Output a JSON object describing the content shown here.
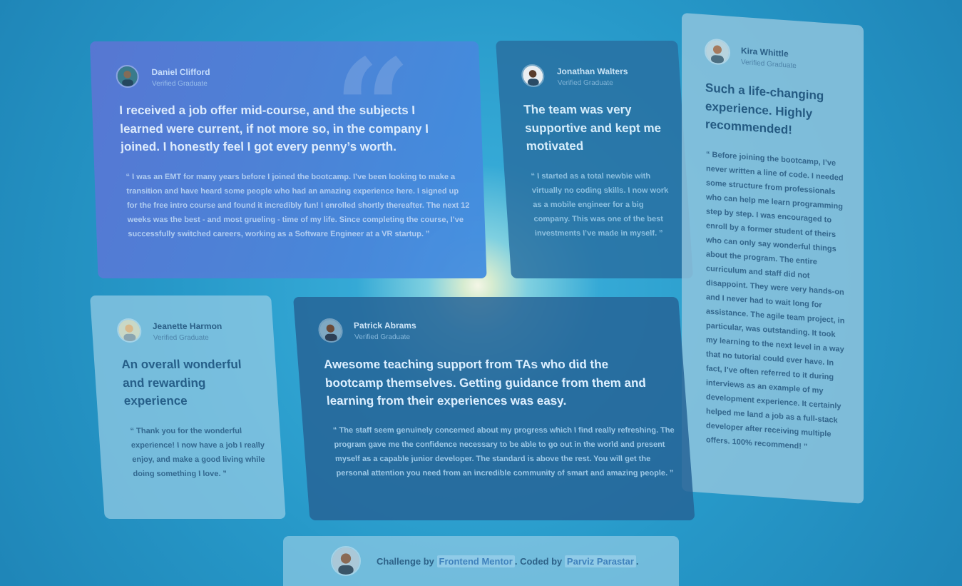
{
  "testimonials": [
    {
      "name": "Daniel Clifford",
      "role": "Verified Graduate",
      "headline": "I received a job offer mid-course, and the subjects I learned were current, if not more so, in the company I joined. I honestly feel I got every penny’s worth.",
      "quote": "“ I was an EMT for many years before I joined the bootcamp. I’ve been looking to make a transition and have heard some people who had an amazing experience here. I signed up for the free intro course and found it incredibly fun! I enrolled shortly thereafter. The next 12 weeks was the best - and most grueling - time of my life. Since completing the course, I’ve successfully switched careers, working as a Software Engineer at a VR startup. ”"
    },
    {
      "name": "Jonathan Walters",
      "role": "Verified Graduate",
      "headline": "The team was very supportive and kept me motivated",
      "quote": "“ I started as a total newbie with virtually no coding skills. I now work as a mobile engineer for a big company. This was one of the best investments I’ve made in myself. ”"
    },
    {
      "name": "Kira Whittle",
      "role": "Verified Graduate",
      "headline": "Such a life-changing experience. Highly recommended!",
      "quote": "“ Before joining the bootcamp, I’ve never written a line of code. I needed some structure from professionals who can help me learn programming step by step. I was encouraged to enroll by a former student of theirs who can only say wonderful things about the program. The entire curriculum and staff did not disappoint. They were very hands-on and I never had to wait long for assistance. The agile team project, in particular, was outstanding. It took my learning to the next level in a way that no tutorial could ever have. In fact, I’ve often referred to it during interviews as an example of my development experience. It certainly helped me land a job as a full-stack developer after receiving multiple offers. 100% recommend! ”"
    },
    {
      "name": "Jeanette Harmon",
      "role": "Verified Graduate",
      "headline": "An overall wonderful and rewarding experience",
      "quote": "“ Thank you for the wonderful experience! I now have a job I really enjoy, and make a good living while doing something I love. ”"
    },
    {
      "name": "Patrick Abrams",
      "role": "Verified Graduate",
      "headline": "Awesome teaching support from TAs who did the bootcamp themselves. Getting guidance from them and learning from their experiences was easy.",
      "quote": "“ The staff seem genuinely concerned about my progress which I find really refreshing. The program gave me the confidence necessary to be able to go out in the world and present myself as a capable junior developer. The standard is above the rest. You will get the personal attention you need from an incredible community of smart and amazing people. ”"
    }
  ],
  "footer": {
    "challenge_prefix": "Challenge by",
    "challenge_link": "Frontend Mentor",
    "separator": ".",
    "coded_prefix": "Coded by",
    "coded_link": "Parviz Parastar",
    "end": "."
  },
  "icons": {
    "quote_mark": "quotation-mark-icon",
    "avatar": "user-avatar-icon"
  },
  "colors": {
    "daniel_card": "#4d83d8",
    "jonathan_card": "#286ea0",
    "kira_card": "#92c6de",
    "jeanette_card": "#96cce4",
    "patrick_card": "#266496"
  }
}
